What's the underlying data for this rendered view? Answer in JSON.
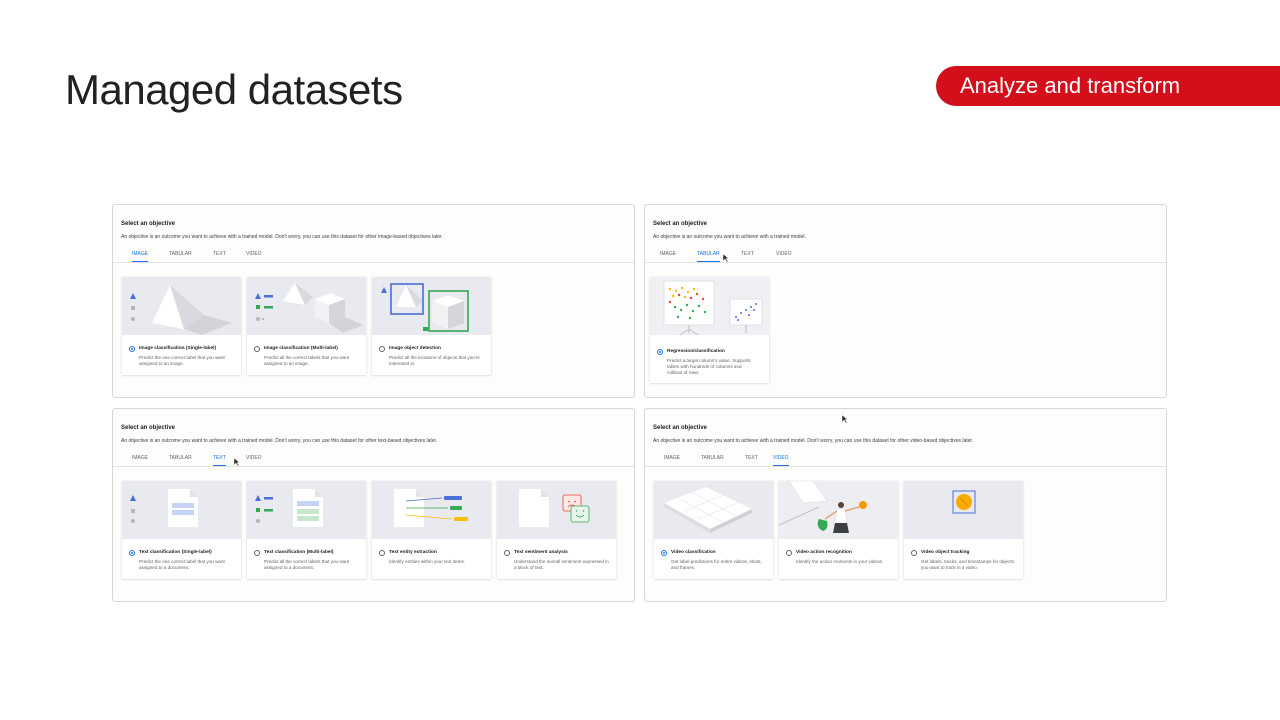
{
  "slide": {
    "title": "Managed datasets",
    "section_label": "Analyze and transform"
  },
  "tabs": [
    "IMAGE",
    "TABULAR",
    "TEXT",
    "VIDEO"
  ],
  "panels": {
    "image": {
      "title": "Select an objective",
      "description": "An objective is an outcome you want to achieve with a trained model. Don't worry, you can use this dataset for other image-based objectives later.",
      "active_tab": "IMAGE",
      "cards": [
        {
          "title": "Image classification (Single-label)",
          "desc": "Predict the one correct label that you want assigned to an image.",
          "checked": true
        },
        {
          "title": "Image classification (Multi-label)",
          "desc": "Predict all the correct labels that you want assigned to an image.",
          "checked": false
        },
        {
          "title": "Image object detection",
          "desc": "Predict all the locations of objects that you're interested in.",
          "checked": false
        }
      ]
    },
    "tabular": {
      "title": "Select an objective",
      "description": "An objective is an outcome you want to achieve with a trained model.",
      "active_tab": "TABULAR",
      "cards": [
        {
          "title": "Regression/classification",
          "desc": "Predict a target column's value. Supports tables with hundreds of columns and millions of rows.",
          "checked": true
        }
      ]
    },
    "text": {
      "title": "Select an objective",
      "description": "An objective is an outcome you want to achieve with a trained model. Don't worry, you can use this dataset for other text-based objectives later.",
      "active_tab": "TEXT",
      "cards": [
        {
          "title": "Text classification (Single-label)",
          "desc": "Predict the one correct label that you want assigned to a document.",
          "checked": true
        },
        {
          "title": "Text classification (Multi-label)",
          "desc": "Predict all the correct labels that you want assigned to a document.",
          "checked": false
        },
        {
          "title": "Text entity extraction",
          "desc": "Identify entities within your text items.",
          "checked": false
        },
        {
          "title": "Text sentiment analysis",
          "desc": "Understand the overall sentiment expressed in a block of text.",
          "checked": false
        }
      ]
    },
    "video": {
      "title": "Select an objective",
      "description": "An objective is an outcome you want to achieve with a trained model. Don't worry, you can use this dataset for other video-based objectives later.",
      "active_tab": "VIDEO",
      "cards": [
        {
          "title": "Video classification",
          "desc": "Get label predictions for entire videos, shots, and frames.",
          "checked": true
        },
        {
          "title": "Video action recognition",
          "desc": "Identify the action moments in your videos.",
          "checked": false
        },
        {
          "title": "Video object tracking",
          "desc": "Get labels, tracks, and timestamps for objects you want to track in a video.",
          "checked": false
        }
      ]
    }
  },
  "colors": {
    "accent_red": "#d30f1c",
    "tab_active_blue": "#1a73e8",
    "illustration_bg": "#e9e9f0"
  }
}
